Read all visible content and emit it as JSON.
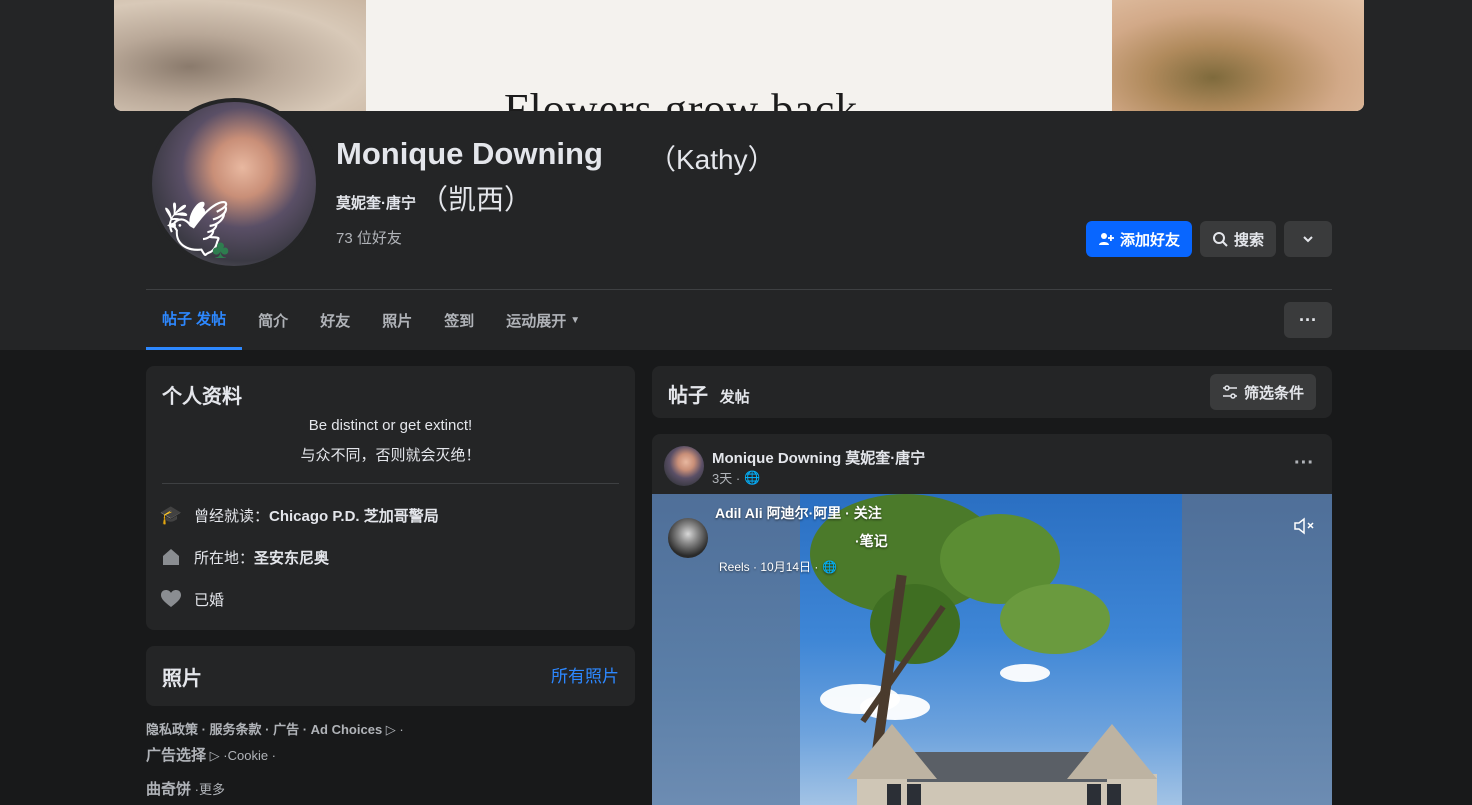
{
  "cover": {
    "text": "Flowers grow back"
  },
  "profile": {
    "name": "Monique Downing",
    "nickname": "（Kathy）",
    "alt_name": "莫妮奎·唐宁",
    "alt_nickname": "（凯西）",
    "friends_count": "73 位好友"
  },
  "actions": {
    "add_friend": "添加好友",
    "search": "搜索"
  },
  "tabs": [
    {
      "label": "帖子 发帖",
      "active": true
    },
    {
      "label": "简介"
    },
    {
      "label": "好友"
    },
    {
      "label": "照片"
    },
    {
      "label": "签到"
    },
    {
      "label": "运动展开"
    }
  ],
  "intro": {
    "title": "个人资料",
    "bio_en": "Be distinct or get extinct!",
    "bio_zh": "与众不同，否则就会灭绝！",
    "education_prefix": "曾经就读：",
    "education": "Chicago P.D. 芝加哥警局",
    "location_prefix": "所在地：",
    "location": "圣安东尼奥",
    "relationship": "已婚"
  },
  "photos": {
    "title": "照片",
    "all_link": "所有照片"
  },
  "footer": {
    "line1": "隐私政策 · 服务条款 · 广告 · Ad Choices",
    "line2_label": "广告选择",
    "line2_rest": " ·Cookie ·",
    "line3_label": "曲奇饼",
    "line3_rest": " ·更多"
  },
  "posts_header": {
    "title": "帖子",
    "subtitle": "发帖",
    "filter": "筛选条件"
  },
  "post": {
    "author": "Monique Downing  莫妮奎·唐宁",
    "time": "3天 ·",
    "reel_author": "Adil Ali  阿迪尔·阿里 · 关注",
    "reel_note": "·笔记",
    "reel_meta": "Reels · 10月14日 ·"
  },
  "colors": {
    "accent": "#0866ff",
    "link": "#2d88ff",
    "card": "#242526",
    "background": "#18191a"
  }
}
